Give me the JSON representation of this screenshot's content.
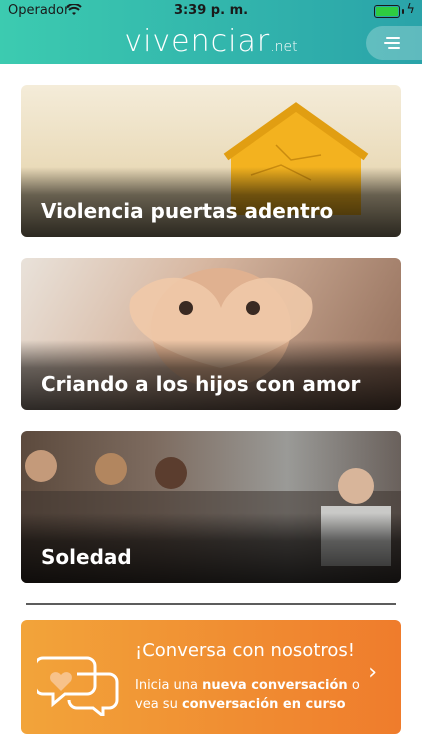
{
  "status": {
    "carrier": "Operador",
    "time": "3:39 p. m."
  },
  "header": {
    "brand_main": "vivenciar",
    "brand_suffix": ".net",
    "menu_icon": "menu-icon"
  },
  "cards": [
    {
      "title": "Violencia puertas adentro"
    },
    {
      "title": "Criando a los hijos con amor"
    },
    {
      "title": "Soledad"
    }
  ],
  "banner": {
    "headline": "¡Conversa con nosotros!",
    "line_prefix": "Inicia una ",
    "link1": "nueva conversación",
    "line_mid": " o vea su  ",
    "link2": "conversación en curso",
    "chevron_icon": "chevron-right-icon",
    "chat_icon": "chat-heart-icon"
  },
  "colors": {
    "header_start": "#3ccbb0",
    "header_end": "#2aa3a9",
    "banner_start": "#f2a43a",
    "banner_end": "#ef7c2c"
  }
}
